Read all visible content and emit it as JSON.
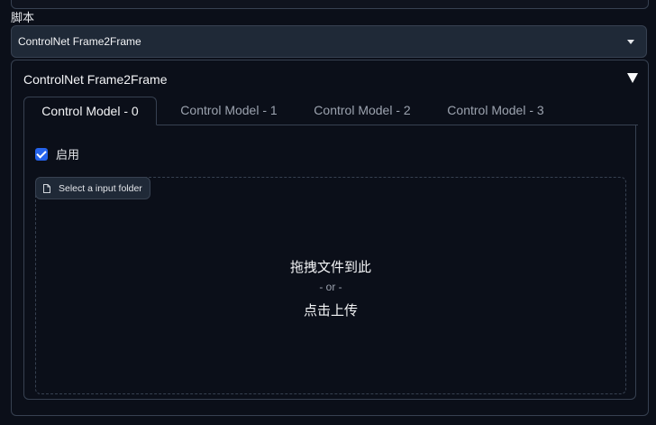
{
  "script_section": {
    "label": "脚本",
    "selected_script": "ControlNet Frame2Frame"
  },
  "accordion": {
    "title": "ControlNet Frame2Frame",
    "tabs": [
      {
        "label": "Control Model - 0",
        "active": true
      },
      {
        "label": "Control Model - 1",
        "active": false
      },
      {
        "label": "Control Model - 2",
        "active": false
      },
      {
        "label": "Control Model - 3",
        "active": false
      }
    ],
    "enable_checkbox": {
      "label": "启用",
      "checked": true
    },
    "upload": {
      "folder_button_label": "Select a input folder",
      "drop_text": "拖拽文件到此",
      "or_text": "- or -",
      "click_text": "点击上传"
    }
  },
  "colors": {
    "background": "#0b0f19",
    "accent": "#2563eb",
    "border": "#374151"
  }
}
